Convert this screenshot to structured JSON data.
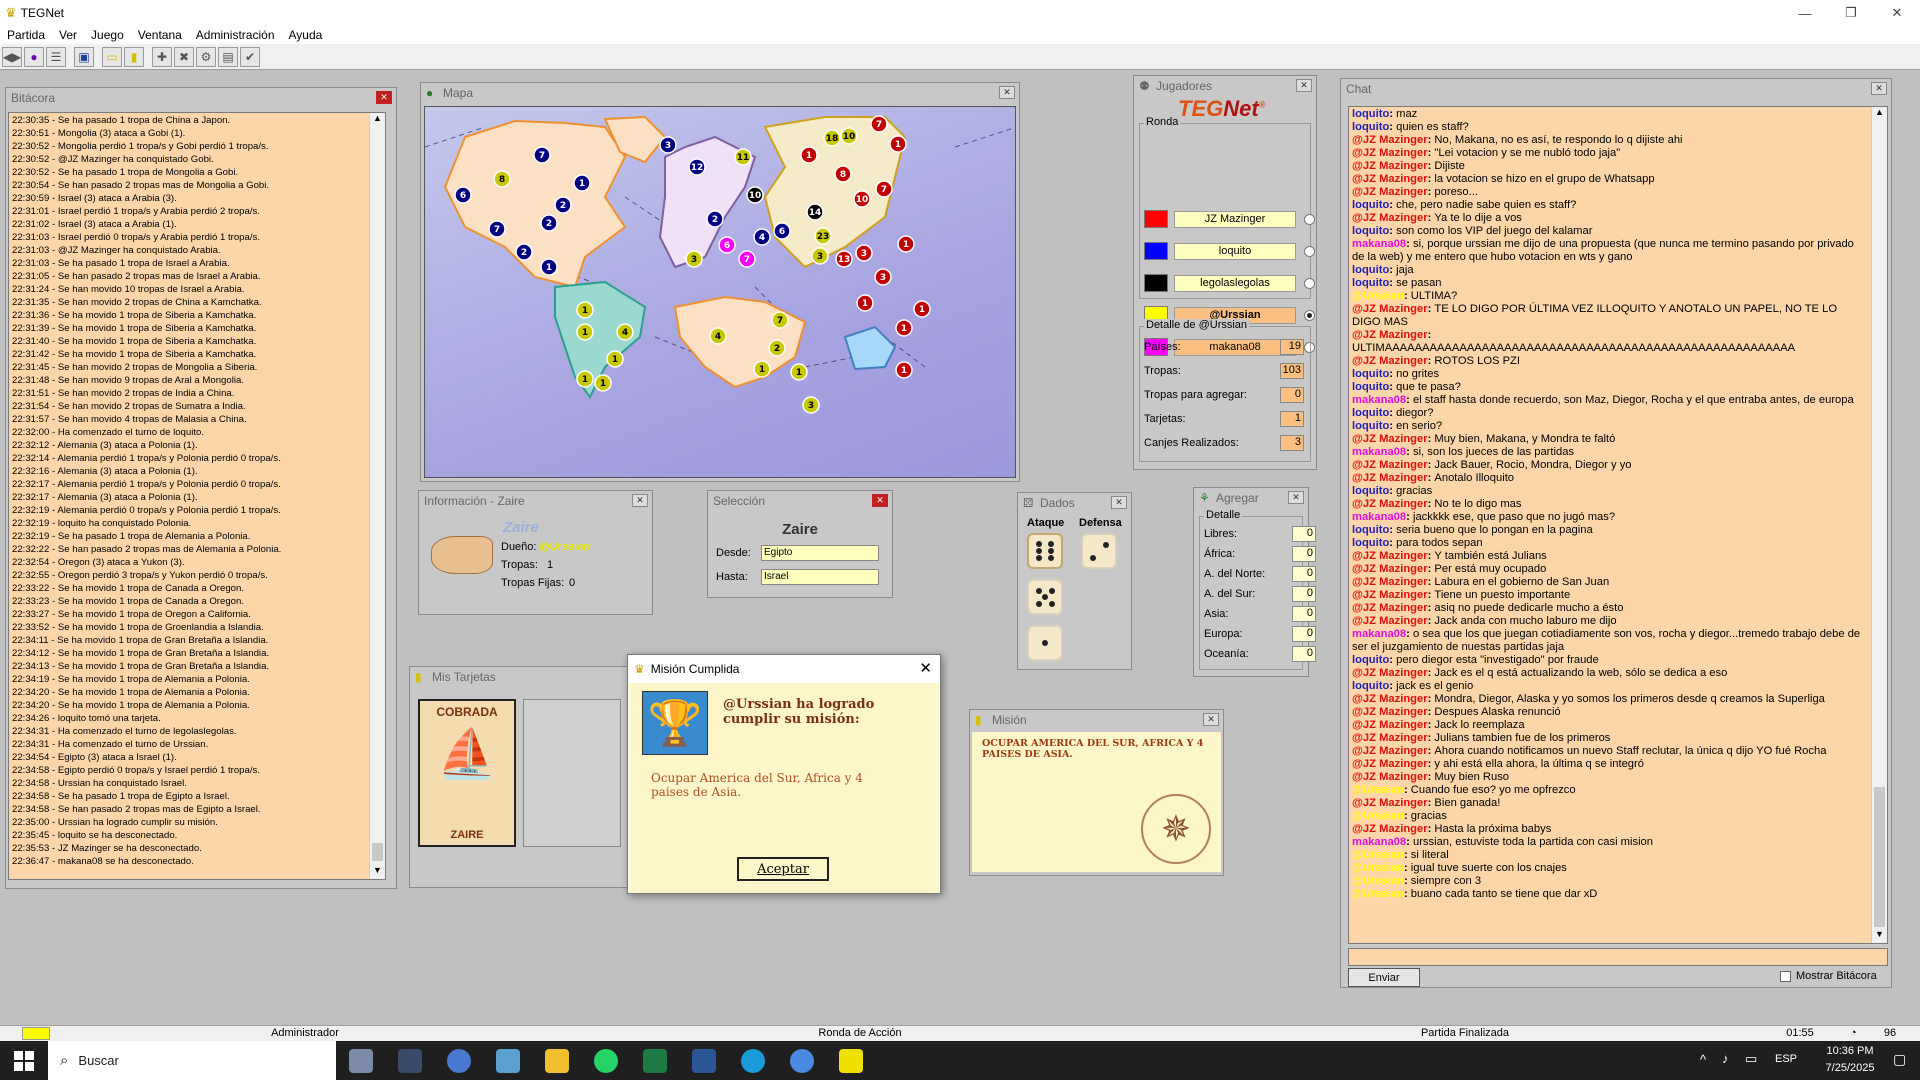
{
  "app": {
    "title": "TEGNet"
  },
  "menu": [
    "Partida",
    "Ver",
    "Juego",
    "Ventana",
    "Administración",
    "Ayuda"
  ],
  "bitacora": {
    "title": "Bitácora",
    "lines": [
      "22:30:35 - Se ha pasado 1 tropa de China a Japon.",
      "22:30:51 - Mongolia (3) ataca a Gobi (1).",
      "22:30:52 - Mongolia perdió 1 tropa/s y Gobi perdió 1 tropa/s.",
      "22:30:52 - @JZ Mazinger ha conquistado Gobi.",
      "22:30:52 - Se ha pasado 1 tropa de Mongolia a Gobi.",
      "22:30:54 - Se han pasado 2 tropas mas de Mongolia a Gobi.",
      "22:30:59 - Israel (3) ataca a Arabia (3).",
      "22:31:01 - Israel perdió 1 tropa/s y Arabia perdió 2 tropa/s.",
      "22:31:02 - Israel (3) ataca a Arabia (1).",
      "22:31:03 - Israel perdió 0 tropa/s y Arabia perdió 1 tropa/s.",
      "22:31:03 - @JZ Mazinger ha conquistado Arabia.",
      "22:31:03 - Se ha pasado 1 tropa de Israel a Arabia.",
      "22:31:05 - Se han pasado 2 tropas mas de Israel a Arabia.",
      "22:31:24 - Se han movido 10 tropas de Israel a Arabia.",
      "22:31:35 - Se han movido 2 tropas de China a Kamchatka.",
      "22:31:36 - Se ha movido 1 tropa de Siberia a Kamchatka.",
      "22:31:39 - Se ha movido 1 tropa de Siberia a Kamchatka.",
      "22:31:40 - Se ha movido 1 tropa de Siberia a Kamchatka.",
      "22:31:42 - Se ha movido 1 tropa de Siberia a Kamchatka.",
      "22:31:45 - Se han movido 2 tropas de Mongolia a Siberia.",
      "22:31:48 - Se han movido 9 tropas de Aral a Mongolia.",
      "22:31:51 - Se han movido 2 tropas de India a China.",
      "22:31:54 - Se han movido 2 tropas de Sumatra a India.",
      "22:31:57 - Se han movido 4 tropas de Malasia a China.",
      "22:32:00 - Ha comenzado el turno de loquito.",
      "22:32:12 - Alemania (3) ataca a Polonia (1).",
      "22:32:14 - Alemania perdió 1 tropa/s y Polonia perdió 0 tropa/s.",
      "22:32:16 - Alemania (3) ataca a Polonia (1).",
      "22:32:17 - Alemania perdió 1 tropa/s y Polonia perdió 0 tropa/s.",
      "22:32:17 - Alemania (3) ataca a Polonia (1).",
      "22:32:19 - Alemania perdió 0 tropa/s y Polonia perdió 1 tropa/s.",
      "22:32:19 - loquito ha conquistado Polonia.",
      "22:32:19 - Se ha pasado 1 tropa de Alemania a Polonia.",
      "22:32:22 - Se han pasado 2 tropas mas de Alemania a Polonia.",
      "22:32:54 - Oregon (3) ataca a Yukon (3).",
      "22:32:55 - Oregon perdió 3 tropa/s y Yukon perdió 0 tropa/s.",
      "22:33:22 - Se ha movido 1 tropa de Canada a Oregon.",
      "22:33:23 - Se ha movido 1 tropa de Canada a Oregon.",
      "22:33:27 - Se ha movido 1 tropa de Oregon a California.",
      "22:33:52 - Se ha movido 1 tropa de Groenlandia a Islandia.",
      "22:34:11 - Se ha movido 1 tropa de Gran Bretaña a Islandia.",
      "22:34:12 - Se ha movido 1 tropa de Gran Bretaña a Islandia.",
      "22:34:13 - Se ha movido 1 tropa de Gran Bretaña a Islandia.",
      "22:34:19 - Se ha movido 1 tropa de Alemania a Polonia.",
      "22:34:20 - Se ha movido 1 tropa de Alemania a Polonia.",
      "22:34:20 - Se ha movido 1 tropa de Alemania a Polonia.",
      "22:34:26 - loquito tomó una tarjeta.",
      "22:34:31 - Ha comenzado el turno de legolaslegolas.",
      "22:34:31 - Ha comenzado el turno de Urssian.",
      "22:34:54 - Egipto (3) ataca a Israel (1).",
      "22:34:58 - Egipto perdió 0 tropa/s y Israel perdió 1 tropa/s.",
      "22:34:58 - Urssian ha conquistado Israel.",
      "22:34:58 - Se ha pasado 1 tropa de Egipto a Israel.",
      "22:34:58 - Se han pasado 2 tropas mas de Egipto a Israel.",
      "22:35:00 - Urssian ha logrado cumplir su misión.",
      "22:35:45 - loquito se ha desconectado.",
      "22:35:53 - JZ Mazinger se ha desconectado.",
      "22:36:47 - makana08 se ha desconectado."
    ]
  },
  "mapa": {
    "title": "Mapa"
  },
  "info": {
    "title": "Información - Zaire",
    "country": "Zaire",
    "dueno_label": "Dueño:",
    "dueno": "@Urssian",
    "tropas_label": "Tropas:",
    "tropas": "1",
    "fijas_label": "Tropas Fijas:",
    "fijas": "0"
  },
  "seleccion": {
    "title": "Selección",
    "country": "Zaire",
    "desde_label": "Desde:",
    "desde": "Egipto",
    "hasta_label": "Hasta:",
    "hasta": "Israel"
  },
  "dados": {
    "title": "Dados",
    "ataque": "Ataque",
    "defensa": "Defensa"
  },
  "tarjetas": {
    "title": "Mis Tarjetas",
    "card_top": "COBRADA",
    "card_bottom": "ZAIRE"
  },
  "jugadores": {
    "title": "Jugadores",
    "logo": "TEGNet",
    "ronda": "Ronda",
    "players": [
      {
        "name": "JZ Mazinger",
        "color": "#ff0000"
      },
      {
        "name": "loquito",
        "color": "#0000ff"
      },
      {
        "name": "legolaslegolas",
        "color": "#000000"
      },
      {
        "name": "@Urssian",
        "color": "#ffff00"
      },
      {
        "name": "makana08",
        "color": "#ff00ff"
      }
    ],
    "detalle_title": "Detalle de @Urssian",
    "detalle": [
      {
        "label": "Países:",
        "value": "19"
      },
      {
        "label": "Tropas:",
        "value": "103"
      },
      {
        "label": "Tropas para agregar:",
        "value": "0"
      },
      {
        "label": "Tarjetas:",
        "value": "1"
      },
      {
        "label": "Canjes Realizados:",
        "value": "3"
      }
    ]
  },
  "agregar": {
    "title": "Agregar",
    "detalle": "Detalle",
    "rows": [
      {
        "label": "Libres:",
        "value": "0"
      },
      {
        "label": "África:",
        "value": "0"
      },
      {
        "label": "A. del Norte:",
        "value": "0"
      },
      {
        "label": "A. del Sur:",
        "value": "0"
      },
      {
        "label": "Asia:",
        "value": "0"
      },
      {
        "label": "Europa:",
        "value": "0"
      },
      {
        "label": "Oceanía:",
        "value": "0"
      }
    ]
  },
  "mision_dialog": {
    "title": "Misión Cumplida",
    "heading": "@Urssian ha logrado cumplir su misión:",
    "text": "Ocupar America del Sur, Africa y 4 paises de Asia.",
    "button": "Aceptar"
  },
  "mision": {
    "title": "Misión",
    "text": "OCUPAR AMERICA DEL SUR, AFRICA Y 4 PAISES DE ASIA."
  },
  "chat": {
    "title": "Chat",
    "send": "Enviar",
    "mostrar": "Mostrar Bitácora",
    "lines": [
      {
        "n": "loquito",
        "c": "#2020c0",
        "t": "maz"
      },
      {
        "n": "loquito",
        "c": "#2020c0",
        "t": "quien es staff?"
      },
      {
        "n": "@JZ Mazinger",
        "c": "#e01010",
        "t": "No, Makana, no es así, te respondo lo q dijiste ahi"
      },
      {
        "n": "@JZ Mazinger",
        "c": "#e01010",
        "t": "\"Lei votacion y se me nubló todo jaja\""
      },
      {
        "n": "@JZ Mazinger",
        "c": "#e01010",
        "t": "Dijiste"
      },
      {
        "n": "@JZ Mazinger",
        "c": "#e01010",
        "t": "la votacion se hizo en el grupo de Whatsapp"
      },
      {
        "n": "@JZ Mazinger",
        "c": "#e01010",
        "t": "poreso..."
      },
      {
        "n": "loquito",
        "c": "#2020c0",
        "t": "che, pero nadie sabe quien es staff?"
      },
      {
        "n": "@JZ Mazinger",
        "c": "#e01010",
        "t": "Ya te lo dije a vos"
      },
      {
        "n": "loquito",
        "c": "#2020c0",
        "t": "son como los VIP del juego del kalamar"
      },
      {
        "n": "makana08",
        "c": "#e010e0",
        "t": "si, porque urssian me dijo de una propuesta (que nunca me termino pasando por privado de la web) y me entero que hubo votacion en wts y gano"
      },
      {
        "n": "loquito",
        "c": "#2020c0",
        "t": "jaja"
      },
      {
        "n": "loquito",
        "c": "#2020c0",
        "t": "se pasan"
      },
      {
        "n": "@Urssian",
        "c": "#ffff00",
        "t": "ULTIMA?"
      },
      {
        "n": "@JZ Mazinger",
        "c": "#e01010",
        "t": "TE LO DIGO POR ÚLTIMA VEZ ILLOQUITO Y ANOTALO UN PAPEL, NO TE LO DIGO MAS"
      },
      {
        "n": "@JZ Mazinger",
        "c": "#e01010",
        "t": "ULTIMAAAAAAAAAAAAAAAAAAAAAAAAAAAAAAAAAAAAAAAAAAAAAAAAAAAAAAA"
      },
      {
        "n": "@JZ Mazinger",
        "c": "#e01010",
        "t": "ROTOS LOS PZI"
      },
      {
        "n": "loquito",
        "c": "#2020c0",
        "t": "no grites"
      },
      {
        "n": "loquito",
        "c": "#2020c0",
        "t": "que te pasa?"
      },
      {
        "n": "makana08",
        "c": "#e010e0",
        "t": "el staff hasta donde recuerdo, son Maz, Diegor, Rocha y el que entraba antes, de europa"
      },
      {
        "n": "loquito",
        "c": "#2020c0",
        "t": "diegor?"
      },
      {
        "n": "loquito",
        "c": "#2020c0",
        "t": "en serio?"
      },
      {
        "n": "@JZ Mazinger",
        "c": "#e01010",
        "t": "Muy bien, Makana, y Mondra te faltó"
      },
      {
        "n": "makana08",
        "c": "#e010e0",
        "t": "si, son los jueces de las partidas"
      },
      {
        "n": "@JZ Mazinger",
        "c": "#e01010",
        "t": "Jack Bauer, Rocio, Mondra, Diegor y yo"
      },
      {
        "n": "@JZ Mazinger",
        "c": "#e01010",
        "t": "Anotalo Illoquito"
      },
      {
        "n": "loquito",
        "c": "#2020c0",
        "t": "gracias"
      },
      {
        "n": "@JZ Mazinger",
        "c": "#e01010",
        "t": "No te lo digo mas"
      },
      {
        "n": "makana08",
        "c": "#e010e0",
        "t": "jackkkk ese, que paso que no jugó mas?"
      },
      {
        "n": "loquito",
        "c": "#2020c0",
        "t": "seria bueno que lo pongan en la pagina"
      },
      {
        "n": "loquito",
        "c": "#2020c0",
        "t": "para todos sepan"
      },
      {
        "n": "@JZ Mazinger",
        "c": "#e01010",
        "t": "Y también está Julians"
      },
      {
        "n": "@JZ Mazinger",
        "c": "#e01010",
        "t": "Per está muy ocupado"
      },
      {
        "n": "@JZ Mazinger",
        "c": "#e01010",
        "t": "Labura en el gobierno de San Juan"
      },
      {
        "n": "@JZ Mazinger",
        "c": "#e01010",
        "t": "Tiene un puesto importante"
      },
      {
        "n": "@JZ Mazinger",
        "c": "#e01010",
        "t": "asiq no puede dedicarle mucho a ésto"
      },
      {
        "n": "@JZ Mazinger",
        "c": "#e01010",
        "t": "Jack anda con mucho laburo me dijo"
      },
      {
        "n": "makana08",
        "c": "#e010e0",
        "t": "o sea que los que juegan cotiadiamente son vos, rocha y diegor...tremedo trabajo debe de ser el juzgamiento de nuestas partidas jaja"
      },
      {
        "n": "loquito",
        "c": "#2020c0",
        "t": "pero diegor esta \"investigado\" por fraude"
      },
      {
        "n": "@JZ Mazinger",
        "c": "#e01010",
        "t": "Jack es el q está actualizando la web, sólo se dedica a eso"
      },
      {
        "n": "loquito",
        "c": "#2020c0",
        "t": "jack es el genio"
      },
      {
        "n": "@JZ Mazinger",
        "c": "#e01010",
        "t": "Mondra, Diegor, Alaska y yo somos los primeros desde q creamos la Superliga"
      },
      {
        "n": "@JZ Mazinger",
        "c": "#e01010",
        "t": "Despues Alaska renunció"
      },
      {
        "n": "@JZ Mazinger",
        "c": "#e01010",
        "t": "Jack lo reemplaza"
      },
      {
        "n": "@JZ Mazinger",
        "c": "#e01010",
        "t": "Julians tambien fue de los primeros"
      },
      {
        "n": "@JZ Mazinger",
        "c": "#e01010",
        "t": "Ahora cuando notificamos un nuevo Staff reclutar, la única q dijo YO fué Rocha"
      },
      {
        "n": "@JZ Mazinger",
        "c": "#e01010",
        "t": "y ahi está ella ahora, la última q se integró"
      },
      {
        "n": "@JZ Mazinger",
        "c": "#e01010",
        "t": "Muy bien Ruso"
      },
      {
        "n": "@Urssian",
        "c": "#ffff00",
        "t": "Cuando fue eso? yo me opfrezco"
      },
      {
        "n": "@JZ Mazinger",
        "c": "#e01010",
        "t": "Bien ganada!"
      },
      {
        "n": "@Urssian",
        "c": "#ffff00",
        "t": "gracias"
      },
      {
        "n": "@JZ Mazinger",
        "c": "#e01010",
        "t": "Hasta la próxima babys"
      },
      {
        "n": "makana08",
        "c": "#e010e0",
        "t": "urssian, estuviste toda la partida con casi mision"
      },
      {
        "n": "@Urssian",
        "c": "#ffff00",
        "t": "si literal"
      },
      {
        "n": "@Urssian",
        "c": "#ffff00",
        "t": "igual tuve suerte con los cnajes"
      },
      {
        "n": "@Urssian",
        "c": "#ffff00",
        "t": "siempre con 3"
      },
      {
        "n": "@Urssian",
        "c": "#ffff00",
        "t": "buano cada tanto se tiene que dar xD"
      }
    ]
  },
  "status": {
    "user": "Administrador",
    "phase": "Ronda de Acción",
    "state": "Partida Finalizada",
    "time": "01:55",
    "count": "96"
  },
  "taskbar": {
    "search": "Buscar",
    "lang": "ESP",
    "time": "10:36 PM",
    "date": "7/25/2025"
  },
  "map_armies": [
    {
      "c": "#000080",
      "t": "7",
      "tc": "#fff"
    },
    {
      "c": "#000080",
      "t": "3",
      "tc": "#fff"
    },
    {
      "c": "#000080",
      "t": "6",
      "tc": "#fff"
    },
    {
      "c": "#c8c800",
      "t": "8",
      "tc": "#000"
    },
    {
      "c": "#000080",
      "t": "1",
      "tc": "#fff"
    },
    {
      "c": "#000080",
      "t": "2",
      "tc": "#fff"
    },
    {
      "c": "#000080",
      "t": "7",
      "tc": "#fff"
    },
    {
      "c": "#000080",
      "t": "2",
      "tc": "#fff"
    },
    {
      "c": "#000080",
      "t": "2",
      "tc": "#fff"
    },
    {
      "c": "#000080",
      "t": "1",
      "tc": "#fff"
    },
    {
      "c": "#000080",
      "t": "12",
      "tc": "#fff"
    },
    {
      "c": "#000080",
      "t": "2",
      "tc": "#fff"
    },
    {
      "c": "#c8c800",
      "t": "11",
      "tc": "#000"
    },
    {
      "c": "#000",
      "t": "10",
      "tc": "#fff"
    },
    {
      "c": "#000",
      "t": "14",
      "tc": "#fff"
    },
    {
      "c": "#000080",
      "t": "4",
      "tc": "#fff"
    },
    {
      "c": "#000080",
      "t": "6",
      "tc": "#fff"
    },
    {
      "c": "#ff00ff",
      "t": "6",
      "tc": "#fff"
    },
    {
      "c": "#ff00ff",
      "t": "7",
      "tc": "#fff"
    },
    {
      "c": "#c8c800",
      "t": "3",
      "tc": "#000"
    },
    {
      "c": "#c00000",
      "t": "1",
      "tc": "#fff"
    },
    {
      "c": "#c8c800",
      "t": "18",
      "tc": "#000"
    },
    {
      "c": "#c8c800",
      "t": "10",
      "tc": "#000"
    },
    {
      "c": "#c00000",
      "t": "7",
      "tc": "#fff"
    },
    {
      "c": "#c00000",
      "t": "1",
      "tc": "#fff"
    },
    {
      "c": "#c00000",
      "t": "8",
      "tc": "#fff"
    },
    {
      "c": "#c00000",
      "t": "10",
      "tc": "#fff"
    },
    {
      "c": "#c00000",
      "t": "7",
      "tc": "#fff"
    },
    {
      "c": "#c00000",
      "t": "3",
      "tc": "#fff"
    },
    {
      "c": "#c8c800",
      "t": "23",
      "tc": "#000"
    },
    {
      "c": "#c8c800",
      "t": "3",
      "tc": "#000"
    },
    {
      "c": "#c00000",
      "t": "13",
      "tc": "#fff"
    },
    {
      "c": "#c00000",
      "t": "1",
      "tc": "#fff"
    },
    {
      "c": "#c00000",
      "t": "3",
      "tc": "#fff"
    },
    {
      "c": "#c00000",
      "t": "1",
      "tc": "#fff"
    },
    {
      "c": "#c00000",
      "t": "1",
      "tc": "#fff"
    },
    {
      "c": "#c00000",
      "t": "1",
      "tc": "#fff"
    },
    {
      "c": "#c00000",
      "t": "1",
      "tc": "#fff"
    },
    {
      "c": "#c8c800",
      "t": "1",
      "tc": "#000"
    },
    {
      "c": "#c8c800",
      "t": "4",
      "tc": "#000"
    },
    {
      "c": "#c8c800",
      "t": "1",
      "tc": "#000"
    },
    {
      "c": "#c8c800",
      "t": "1",
      "tc": "#000"
    },
    {
      "c": "#c8c800",
      "t": "1",
      "tc": "#000"
    },
    {
      "c": "#c8c800",
      "t": "1",
      "tc": "#000"
    },
    {
      "c": "#c8c800",
      "t": "7",
      "tc": "#000"
    },
    {
      "c": "#c8c800",
      "t": "4",
      "tc": "#000"
    },
    {
      "c": "#c8c800",
      "t": "2",
      "tc": "#000"
    },
    {
      "c": "#c8c800",
      "t": "1",
      "tc": "#000"
    },
    {
      "c": "#c8c800",
      "t": "1",
      "tc": "#000"
    },
    {
      "c": "#c8c800",
      "t": "3",
      "tc": "#000"
    }
  ]
}
